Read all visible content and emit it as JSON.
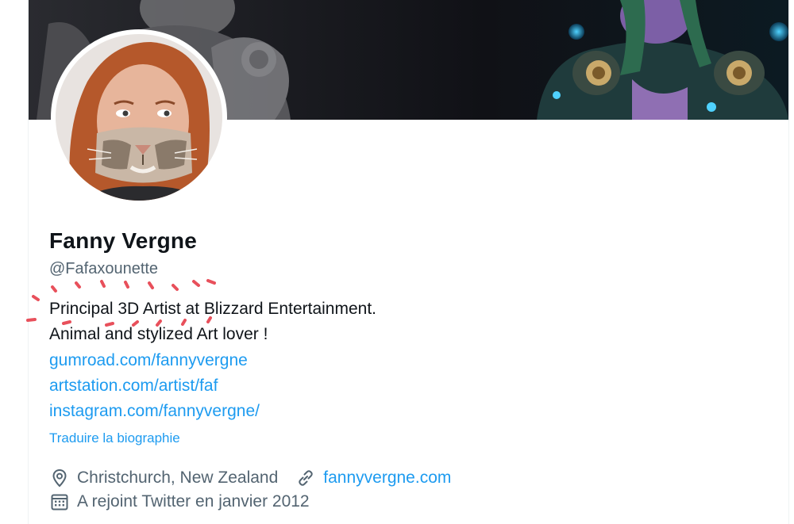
{
  "profile": {
    "display_name": "Fanny Vergne",
    "handle": "@Fafaxounette",
    "bio_lines": [
      "Principal 3D Artist at Blizzard Entertainment.",
      "Animal and stylized Art lover !"
    ],
    "bio_links": [
      "gumroad.com/fannyvergne",
      "artstation.com/artist/faf",
      "instagram.com/fannyvergne/"
    ],
    "translate_label": "Traduire la biographie",
    "location": "Christchurch, New Zealand",
    "website": "fannyvergne.com",
    "joined": "A rejoint Twitter en janvier 2012"
  },
  "icons": {
    "location": "location-pin-icon",
    "website": "link-icon",
    "joined": "calendar-icon"
  },
  "colors": {
    "link": "#1d9bf0",
    "text_primary": "#0f1419",
    "text_secondary": "#536471",
    "annotation": "#e8505b"
  }
}
